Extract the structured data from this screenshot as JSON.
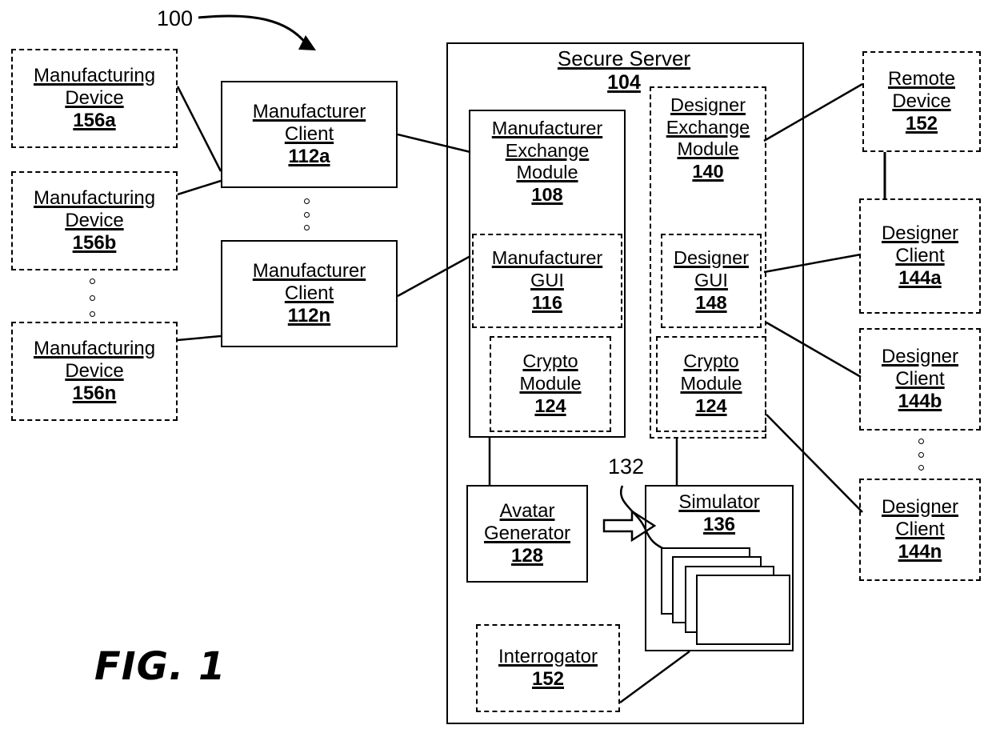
{
  "figure": {
    "caption": "FIG. 1",
    "system_callout": "100",
    "simulation_callout": "132"
  },
  "manufacturing_devices": [
    {
      "line1": "Manufacturing",
      "line2": "Device",
      "ref": "156a"
    },
    {
      "line1": "Manufacturing",
      "line2": "Device",
      "ref": "156b"
    },
    {
      "line1": "Manufacturing",
      "line2": "Device",
      "ref": "156n"
    }
  ],
  "manufacturer_clients": [
    {
      "line1": "Manufacturer",
      "line2": "Client",
      "ref": "112a"
    },
    {
      "line1": "Manufacturer",
      "line2": "Client",
      "ref": "112n"
    }
  ],
  "secure_server": {
    "title": "Secure Server",
    "ref": "104",
    "manufacturer_exchange_module": {
      "line1": "Manufacturer",
      "line2": "Exchange",
      "line3": "Module",
      "ref": "108"
    },
    "manufacturer_gui": {
      "line1": "Manufacturer",
      "line2": "GUI",
      "ref": "116"
    },
    "manufacturer_crypto_module": {
      "line1": "Crypto",
      "line2": "Module",
      "ref": "124"
    },
    "designer_exchange_module": {
      "line1": "Designer",
      "line2": "Exchange",
      "line3": "Module",
      "ref": "140"
    },
    "designer_gui": {
      "line1": "Designer",
      "line2": "GUI",
      "ref": "148"
    },
    "designer_crypto_module": {
      "line1": "Crypto",
      "line2": "Module",
      "ref": "124"
    },
    "avatar_generator": {
      "line1": "Avatar",
      "line2": "Generator",
      "ref": "128"
    },
    "simulator": {
      "line1": "Simulator",
      "ref": "136"
    },
    "interrogator": {
      "line1": "Interrogator",
      "ref": "152"
    }
  },
  "remote_device": {
    "line1": "Remote",
    "line2": "Device",
    "ref": "152"
  },
  "designer_clients": [
    {
      "line1": "Designer",
      "line2": "Client",
      "ref": "144a"
    },
    {
      "line1": "Designer",
      "line2": "Client",
      "ref": "144b"
    },
    {
      "line1": "Designer",
      "line2": "Client",
      "ref": "144n"
    }
  ],
  "colors": {
    "stroke": "#000000",
    "background": "#ffffff"
  }
}
